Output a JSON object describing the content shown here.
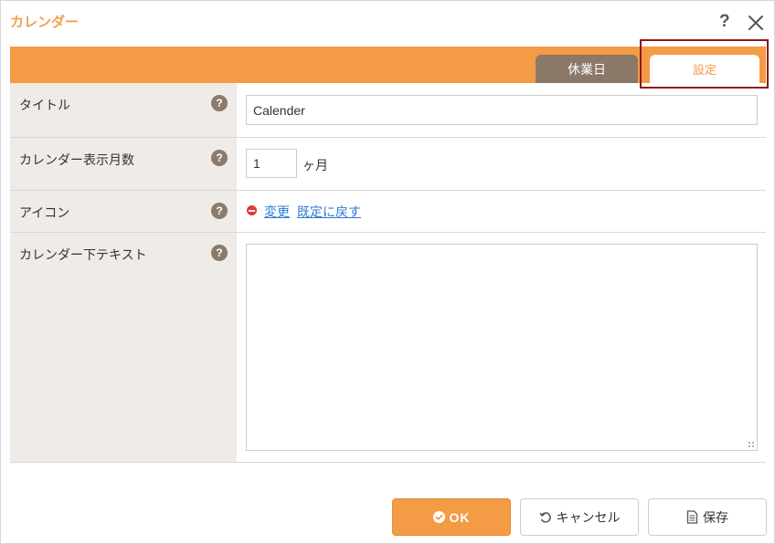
{
  "dialog": {
    "title": "カレンダー",
    "help_icon": "?",
    "close_icon": "close-icon"
  },
  "tabs": [
    {
      "label": "休業日",
      "active": false
    },
    {
      "label": "設定",
      "active": true
    }
  ],
  "form": {
    "title": {
      "label": "タイトル",
      "value": "Calender"
    },
    "months": {
      "label": "カレンダー表示月数",
      "value": "1",
      "unit": "ヶ月"
    },
    "icon": {
      "label": "アイコン",
      "change_link": "変更",
      "reset_link": "既定に戻す"
    },
    "below_text": {
      "label": "カレンダー下テキスト",
      "value": ""
    },
    "help_glyph": "?"
  },
  "buttons": {
    "ok": "OK",
    "cancel": "キャンセル",
    "save": "保存"
  },
  "colors": {
    "accent": "#f49b46",
    "tab_inactive": "#8a7868",
    "label_bg": "#efebe6",
    "highlight_frame": "#8b1a1a",
    "link": "#2b7bd6",
    "delete_red": "#e53935"
  }
}
